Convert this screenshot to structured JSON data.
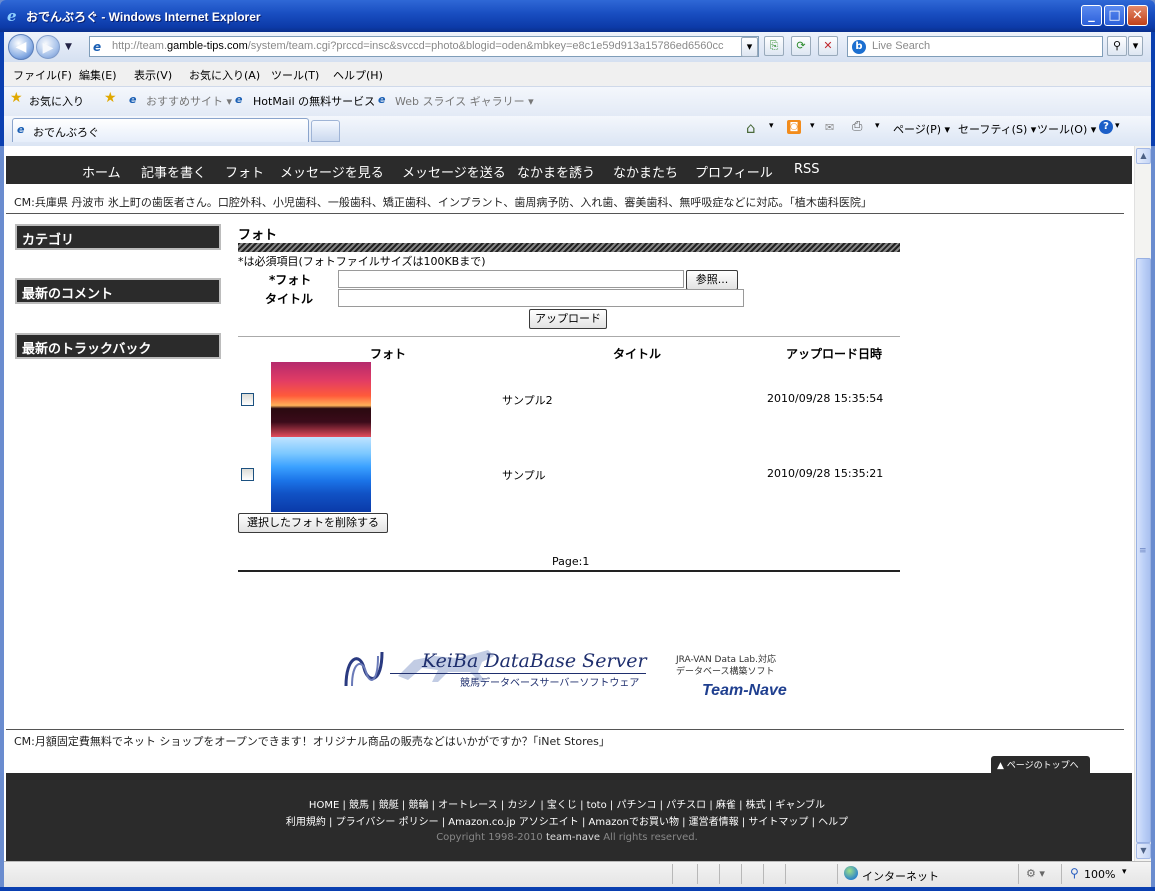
{
  "window": {
    "title": "おでんぶろぐ - Windows Internet Explorer",
    "minimize": "_",
    "maximize": "□",
    "close": "✕"
  },
  "address": {
    "url_prefix": "http://team.",
    "url_domain": "gamble-tips.com",
    "url_rest": "/system/team.cgi?prccd=insc&svccd=photo&blogid=oden&mbkey=e8c1e59d913a15786ed6560cc",
    "search_placeholder": "Live Search"
  },
  "menu": [
    "ファイル(F)",
    "編集(E)",
    "表示(V)",
    "お気に入り(A)",
    "ツール(T)",
    "ヘルプ(H)"
  ],
  "favorites": {
    "label": "お気に入り",
    "suggested": "おすすめサイト ▾",
    "hotmail": "HotMail の無料サービス",
    "webslice": "Web スライス ギャラリー ▾"
  },
  "tab": {
    "title": "おでんぶろぐ"
  },
  "commands": [
    "ページ(P) ▾",
    "セーフティ(S) ▾",
    "ツール(O) ▾"
  ],
  "page": {
    "nav": [
      "ホーム",
      "記事を書く",
      "フォト",
      "メッセージを見る",
      "メッセージを送る",
      "なかまを誘う",
      "なかまたち",
      "プロフィール",
      "RSS"
    ],
    "cm_top": "CM:兵庫県 丹波市 氷上町の歯医者さん。口腔外科、小児歯科、一般歯科、矯正歯科、インプラント、歯周病予防、入れ歯、審美歯科、無呼吸症などに対応。｢植木歯科医院｣",
    "sidebar": [
      "カテゴリ",
      "最新のコメント",
      "最新のトラックバック"
    ],
    "section_title": "フォト",
    "required_note": "*は必須項目(フォトファイルサイズは100KBまで)",
    "photo_label": "*フォト",
    "title_label": "タイトル",
    "browse_button": "参照...",
    "upload_button": "アップロード",
    "col_photo": "フォト",
    "col_title": "タイトル",
    "col_date": "アップロード日時",
    "rows": [
      {
        "title": "サンプル2",
        "date": "2010/09/28 15:35:54"
      },
      {
        "title": "サンプル",
        "date": "2010/09/28 15:35:21"
      }
    ],
    "delete_button": "選択したフォトを削除する",
    "page_indicator": "Page:1",
    "banner": {
      "main": "KeiBa DataBase Server",
      "sub": "競馬データベースサーバーソフトウェア",
      "jra1": "JRA-VAN Data Lab.対応",
      "jra2": "データベース構築ソフト",
      "team": "Team-Nave"
    },
    "cm_bottom": "CM:月額固定費無料でネット ショップをオープンできます！オリジナル商品の販売などはいかがですか？｢iNet Stores｣",
    "page_top": "▲ ページのトップへ",
    "footer_line1": "HOME | 競馬 | 競艇 | 競輪 | オートレース | カジノ | 宝くじ | toto | パチンコ | パチスロ | 麻雀 | 株式 | ギャンブル",
    "footer_line2": "利用規約 | プライバシー ポリシー | Amazon.co.jp アソシエイト | Amazonでお買い物 | 運営者情報 | サイトマップ | ヘルプ",
    "copyright_pre": "Copyright 1998-2010 ",
    "copyright_name": "team-nave",
    "copyright_post": " All rights reserved."
  },
  "status": {
    "zone": "インターネット",
    "zoom": "100%"
  }
}
